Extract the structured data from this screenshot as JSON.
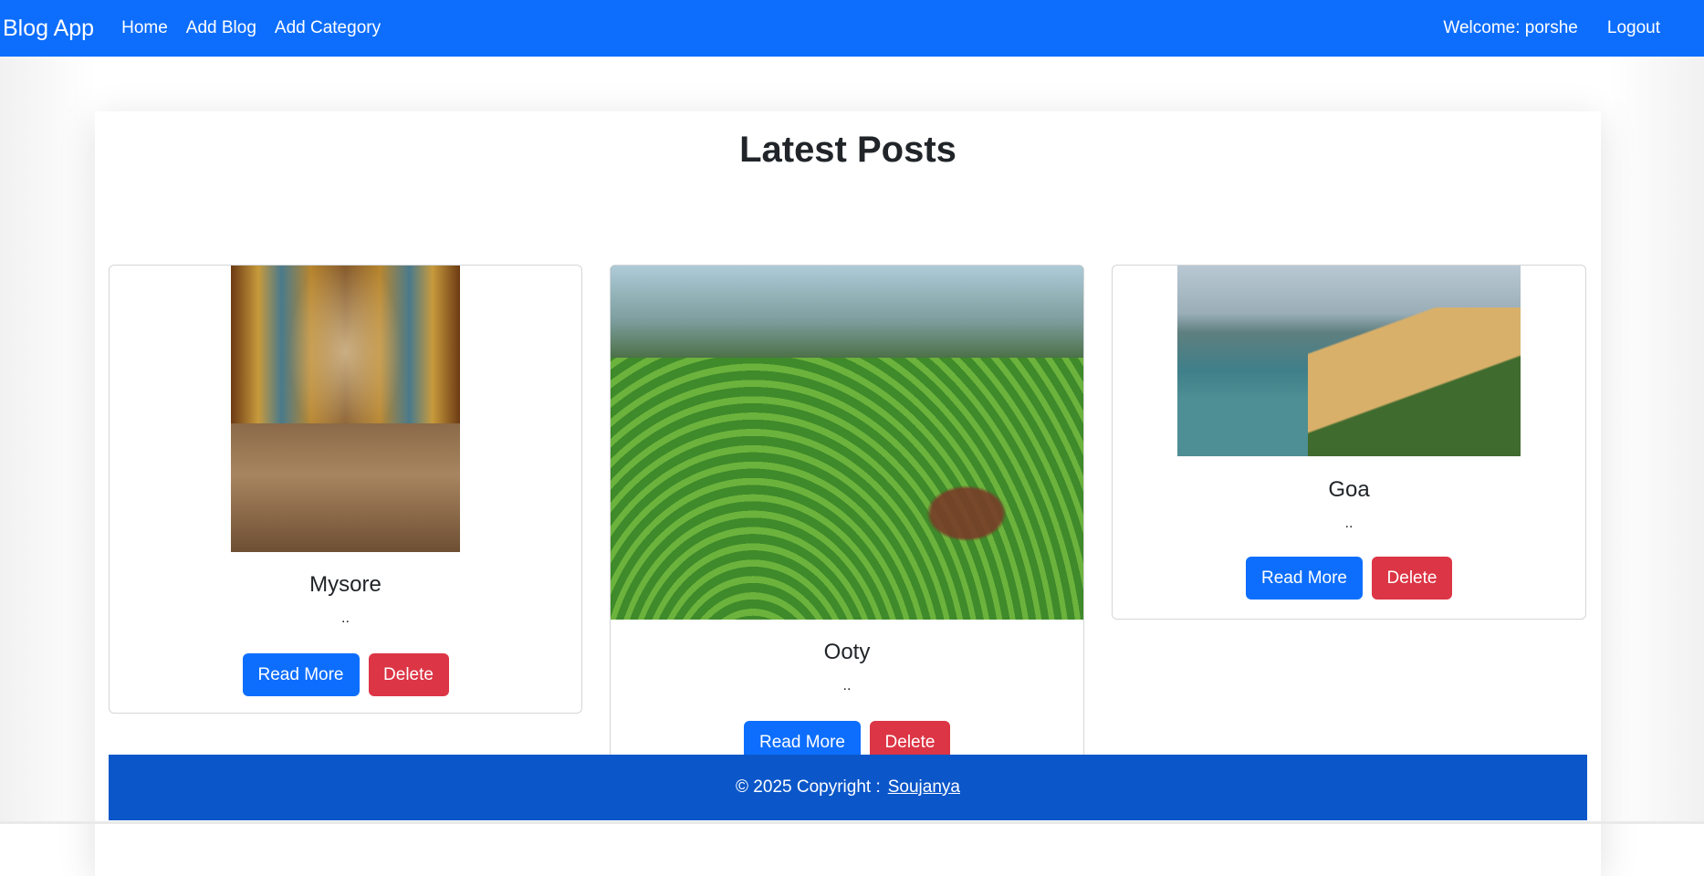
{
  "navbar": {
    "brand": "Blog App",
    "links": [
      "Home",
      "Add Blog",
      "Add Category"
    ],
    "welcome": "Welcome: porshe",
    "logout": "Logout"
  },
  "main": {
    "heading": "Latest Posts",
    "posts": [
      {
        "title": "Mysore",
        "excerpt": "..",
        "read_more": "Read More",
        "delete": "Delete"
      },
      {
        "title": "Ooty",
        "excerpt": "..",
        "read_more": "Read More",
        "delete": "Delete"
      },
      {
        "title": "Goa",
        "excerpt": "..",
        "read_more": "Read More",
        "delete": "Delete"
      }
    ]
  },
  "footer": {
    "copyright": "© 2025 Copyright :",
    "author": "Soujanya"
  },
  "colors": {
    "primary": "#0d6efd",
    "danger": "#dc3545",
    "footer": "#0b57c9"
  }
}
